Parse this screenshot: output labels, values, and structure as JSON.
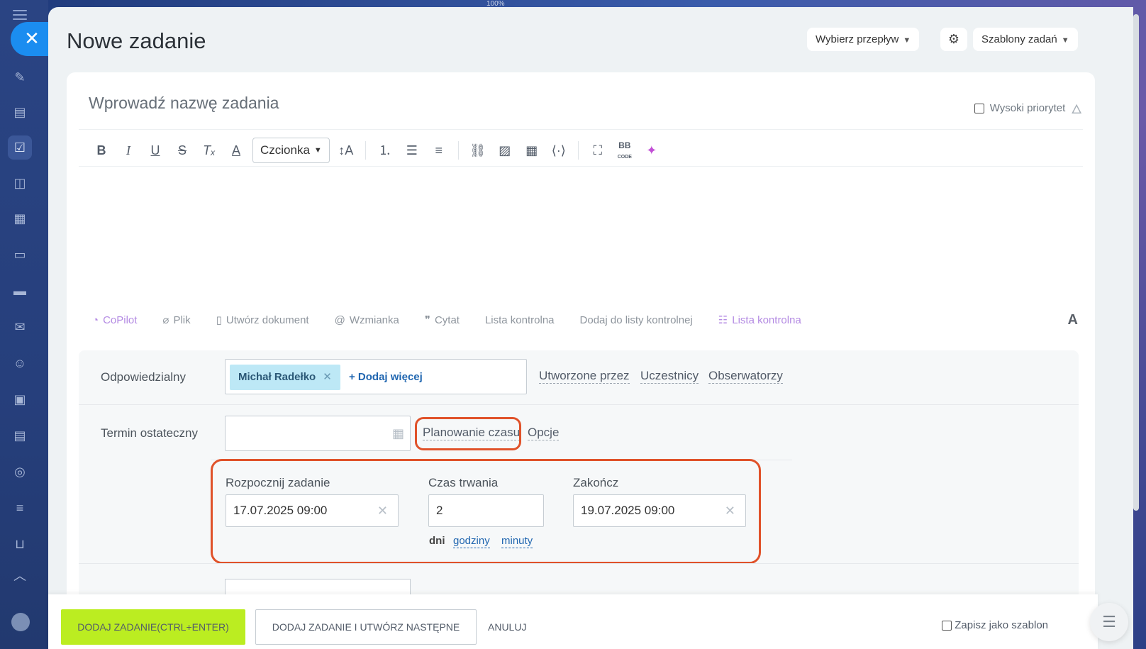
{
  "zoom": "100%",
  "page": {
    "title": "Nowe zadanie",
    "flow_button": "Wybierz przepływ",
    "templates_button": "Szablony zadań"
  },
  "task": {
    "name_placeholder": "Wprowadź nazwę zadania",
    "high_priority_label": "Wysoki priorytet"
  },
  "editor": {
    "font_select": "Czcionka",
    "toolbar_icons": [
      "bold-icon",
      "italic-icon",
      "underline-icon",
      "strikethrough-icon",
      "clear-format-icon",
      "text-color-icon",
      "font-size-icon",
      "numbered-list-icon",
      "bullet-list-icon",
      "align-icon",
      "link-icon",
      "image-icon",
      "table-icon",
      "code-icon",
      "fullscreen-icon",
      "bbcode-icon",
      "ai-image-icon"
    ]
  },
  "actions": {
    "copilot": "CoPilot",
    "file": "Plik",
    "create_document": "Utwórz dokument",
    "mention": "Wzmianka",
    "quote": "Cytat",
    "checklist": "Lista kontrolna",
    "add_to_checklist": "Dodaj do listy kontrolnej",
    "checklist2": "Lista kontrolna",
    "font_toggle": "A"
  },
  "form": {
    "responsible_label": "Odpowiedzialny",
    "responsible_chip": "Michał Radełko",
    "add_more": "+ Dodaj więcej",
    "created_by": "Utworzone przez",
    "participants": "Uczestnicy",
    "observers": "Obserwatorzy",
    "deadline_label": "Termin ostateczny",
    "deadline_value": "",
    "time_planning": "Planowanie czasu",
    "options": "Opcje",
    "start_label": "Rozpocznij zadanie",
    "start_value": "17.07.2025 09:00",
    "duration_label": "Czas trwania",
    "duration_value": "2",
    "end_label": "Zakończ",
    "end_value": "19.07.2025 09:00",
    "unit_days": "dni",
    "unit_hours": "godziny",
    "unit_minutes": "minuty"
  },
  "footer": {
    "add_task": "DODAJ ZADANIE(CTRL+ENTER)",
    "add_and_next": "DODAJ ZADANIE I UTWÓRZ NASTĘPNE",
    "cancel": "ANULUJ",
    "save_template": "Zapisz jako szablon"
  },
  "colors": {
    "accent_green": "#bbed21",
    "highlight": "#e0522a",
    "link_blue": "#2066b0",
    "chip_bg": "#bde8f6"
  }
}
